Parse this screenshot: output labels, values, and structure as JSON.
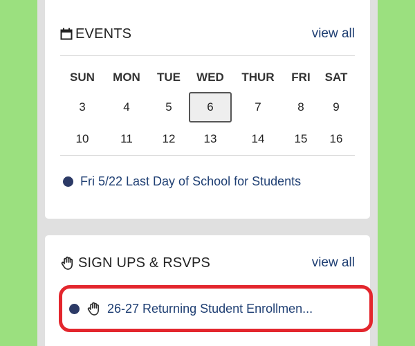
{
  "events": {
    "title": "EVENTS",
    "view_all": "view all",
    "days": [
      "SUN",
      "MON",
      "TUE",
      "WED",
      "THUR",
      "FRI",
      "SAT"
    ],
    "week1": [
      "3",
      "4",
      "5",
      "6",
      "7",
      "8",
      "9"
    ],
    "week2": [
      "10",
      "11",
      "12",
      "13",
      "14",
      "15",
      "16"
    ],
    "today": "6",
    "item": "Fri 5/22 Last Day of School for Students"
  },
  "signups": {
    "title": "SIGN UPS & RSVPS",
    "view_all": "view all",
    "item": "26-27 Returning Student Enrollmen..."
  },
  "colors": {
    "background": "#9be07f",
    "link": "#1f3f73",
    "dot": "#2c3a66",
    "highlight": "#e3262d"
  },
  "icons": {
    "events": "calendar-icon",
    "signups": "hand-icon"
  }
}
